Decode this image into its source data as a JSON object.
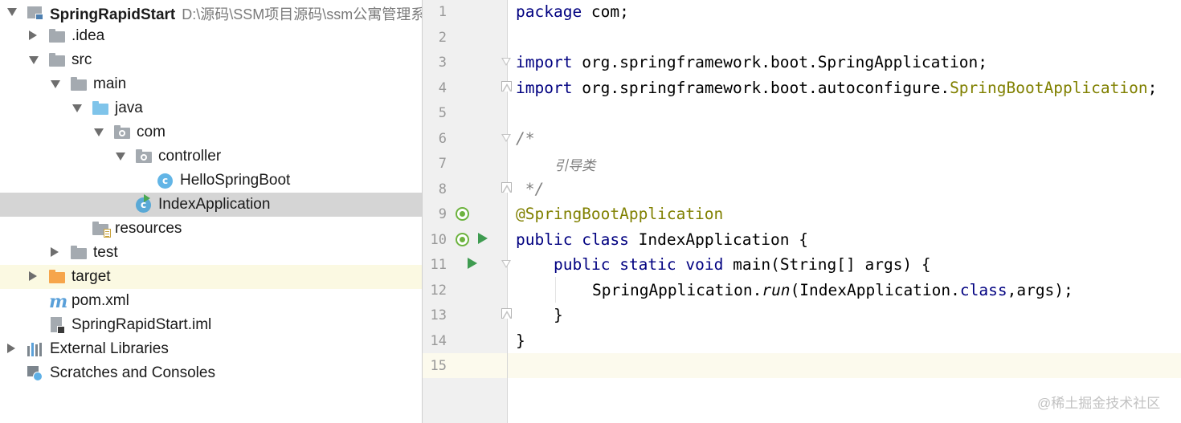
{
  "project_tree": {
    "root": {
      "label": "SpringRapidStart",
      "path": "D:\\源码\\SSM项目源码\\ssm公寓管理系"
    },
    "items": [
      {
        "label": ".idea"
      },
      {
        "label": "src"
      },
      {
        "label": "main"
      },
      {
        "label": "java"
      },
      {
        "label": "com"
      },
      {
        "label": "controller"
      },
      {
        "label": "HelloSpringBoot"
      },
      {
        "label": "IndexApplication"
      },
      {
        "label": "resources"
      },
      {
        "label": "test"
      },
      {
        "label": "target"
      },
      {
        "label": "pom.xml"
      },
      {
        "label": "SpringRapidStart.iml"
      },
      {
        "label": "External Libraries"
      },
      {
        "label": "Scratches and Consoles"
      }
    ],
    "selected_item": "IndexApplication"
  },
  "editor": {
    "line_numbers": [
      "1",
      "2",
      "3",
      "4",
      "5",
      "6",
      "7",
      "8",
      "9",
      "10",
      "11",
      "12",
      "13",
      "14",
      "15"
    ],
    "lines": {
      "l1": {
        "kw": "package",
        "rest": " com;"
      },
      "l3": {
        "kw": "import",
        "rest": " org.springframework.boot.SpringApplication;"
      },
      "l4": {
        "kw": "import",
        "rest": " org.springframework.boot.autoconfigure.",
        "ann": "SpringBootApplication",
        "end": ";"
      },
      "l6": {
        "cmt": "/*"
      },
      "l7": {
        "cmt": "引导类"
      },
      "l8": {
        "cmt": " */"
      },
      "l9": {
        "ann": "@SpringBootApplication"
      },
      "l10": {
        "kw1": "public",
        "kw2": "class",
        "rest": " IndexApplication {"
      },
      "l11": {
        "kw1": "public",
        "kw2": "static",
        "kw3": "void",
        "rest": " main(String[] args) {"
      },
      "l12": {
        "pre": "SpringApplication.",
        "it": "run",
        "mid": "(IndexApplication.",
        "kw": "class",
        "end": ",args);"
      },
      "l13": {
        "text": "}"
      },
      "l14": {
        "text": "}"
      }
    }
  },
  "watermark": "@稀土掘金技术社区",
  "colors": {
    "keyword": "#000080",
    "annotation": "#808000",
    "comment": "#808080",
    "selection": "#d5d5d5",
    "current_line": "#fcfaed"
  }
}
